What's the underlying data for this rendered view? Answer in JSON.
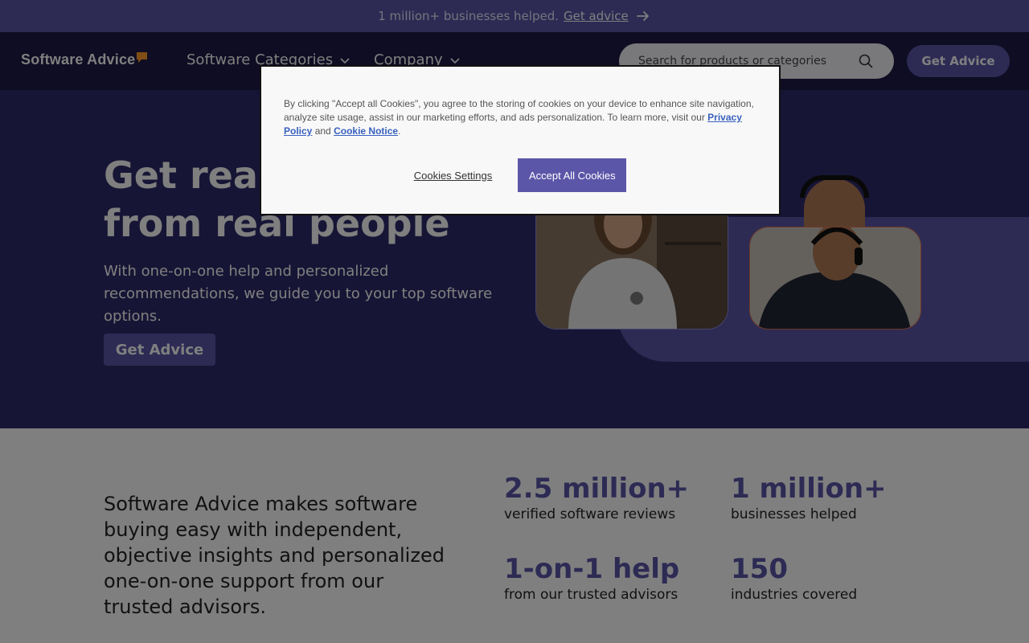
{
  "banner": {
    "text": "1 million+ businesses helped.",
    "link": "Get advice",
    "arrow_icon": "arrow-right-icon"
  },
  "nav": {
    "logo": "Software Advice",
    "items": [
      {
        "label": "Software Categories"
      },
      {
        "label": "Company"
      }
    ],
    "search_placeholder": "Search for products or categories",
    "cta": "Get Advice"
  },
  "hero": {
    "title": "Get real advice from real people",
    "subtitle": "With one-on-one help and personalized recommendations, we guide you to your top software options.",
    "cta": "Get Advice"
  },
  "cookie": {
    "text_before": "By clicking \"Accept all Cookies\", you agree to the storing of cookies on your device to enhance site navigation, analyze site usage, assist in our marketing efforts, and ads personalization. To learn more, visit our",
    "privacy": "Privacy Policy",
    "and": "and",
    "notice": "Cookie Notice",
    "settings": "Cookies Settings",
    "accept": "Accept All Cookies"
  },
  "stats": {
    "lead": "Software Advice makes software buying easy with independent, objective insights and personalized one-on-one support from our trusted advisors.",
    "items": [
      {
        "value": "2.5 million+",
        "label": "verified software reviews"
      },
      {
        "value": "1 million+",
        "label": "businesses helped"
      },
      {
        "value": "1-on-1 help",
        "label": "from our trusted advisors"
      },
      {
        "value": "150",
        "label": "industries covered"
      }
    ]
  },
  "colors": {
    "brand": "#5b56a8",
    "navy": "#1e1a47",
    "hero": "#2f2a6b",
    "accent": "#ff9d28"
  }
}
